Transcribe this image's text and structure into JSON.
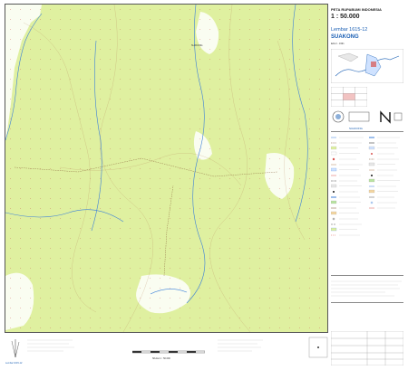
{
  "map": {
    "series_title": "PETA RUPABUMI INDONESIA",
    "scale": "1 : 50.000",
    "sheet_label": "Lembar 1615-12",
    "sheet_name": "SUAKONG",
    "edition": "Edisi I - 1991",
    "place_names": [
      "SUAKONG"
    ],
    "accent_blue": "#1a5fb4",
    "forest_green": "#dff0a0",
    "clearing_white": "#ffffff",
    "river_blue": "#3b7fd9",
    "contour_brown": "#b5835a",
    "grid_red": "#d9534f"
  },
  "panel": {
    "index_caption": "SUAKONG"
  },
  "bottom": {
    "scale_caption": "SKALA 1 : 50.000"
  }
}
